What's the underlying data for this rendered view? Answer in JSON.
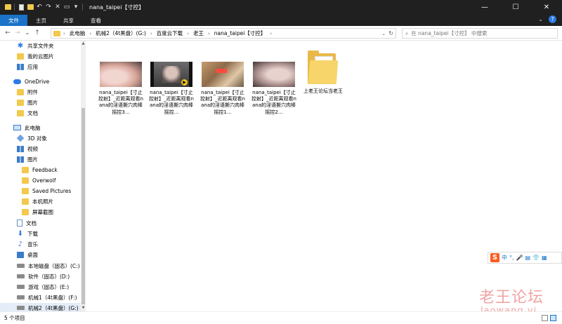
{
  "window": {
    "title": "nana_taipei【寸控】",
    "min_symbol": "—",
    "max_symbol": "☐",
    "close_symbol": "✕"
  },
  "quick_access": {
    "down_arrow": "▾"
  },
  "ribbon": {
    "tabs": [
      {
        "label": "文件",
        "active": true
      },
      {
        "label": "主页",
        "active": false
      },
      {
        "label": "共享",
        "active": false
      },
      {
        "label": "查看",
        "active": false
      }
    ],
    "expand_symbol": "⌄",
    "help_symbol": "?"
  },
  "navigation": {
    "back": "←",
    "forward": "→",
    "recent": "⌄",
    "up": "↑"
  },
  "address": {
    "crumbs": [
      "此电脑",
      "机械2（4t黑盘）(G:)",
      "百度云下载",
      "老王",
      "nana_taipei【寸控】"
    ],
    "separator": "›",
    "dropdown": "⌄",
    "refresh": "↻"
  },
  "search": {
    "placeholder": "在 nana_taipei【寸控】 中搜索",
    "icon": "⌕"
  },
  "nav_pane": {
    "items": [
      {
        "label": "共享文件夹",
        "icon": "star-icon",
        "indent": 1
      },
      {
        "label": "我的云图片",
        "icon": "folder-icon",
        "indent": 1
      },
      {
        "label": "应用",
        "icon": "apps-icon",
        "indent": 1
      },
      {
        "label": "OneDrive",
        "icon": "cloud-icon",
        "indent": 0
      },
      {
        "label": "附件",
        "icon": "folder-icon",
        "indent": 1
      },
      {
        "label": "图片",
        "icon": "folder-icon",
        "indent": 1
      },
      {
        "label": "文档",
        "icon": "folder-icon",
        "indent": 1
      },
      {
        "label": "此电脑",
        "icon": "pc-icon",
        "indent": 0
      },
      {
        "label": "3D 对象",
        "icon": "3d-objects-icon",
        "indent": 1
      },
      {
        "label": "视频",
        "icon": "video-icon",
        "indent": 1
      },
      {
        "label": "图片",
        "icon": "pictures-icon",
        "indent": 1
      },
      {
        "label": "Feedback",
        "icon": "folder-icon",
        "indent": 2
      },
      {
        "label": "Overwolf",
        "icon": "folder-icon",
        "indent": 2
      },
      {
        "label": "Saved Pictures",
        "icon": "folder-icon",
        "indent": 2
      },
      {
        "label": "本机照片",
        "icon": "folder-icon",
        "indent": 2
      },
      {
        "label": "屏幕截图",
        "icon": "folder-icon",
        "indent": 2
      },
      {
        "label": "文档",
        "icon": "document-icon",
        "indent": 1
      },
      {
        "label": "下载",
        "icon": "download-icon",
        "indent": 1
      },
      {
        "label": "音乐",
        "icon": "music-icon",
        "indent": 1
      },
      {
        "label": "桌面",
        "icon": "desktop-icon",
        "indent": 1
      },
      {
        "label": "本地磁盘（固态）(C:)",
        "icon": "drive-icon",
        "indent": 1
      },
      {
        "label": "软件（固态）(D:)",
        "icon": "drive-icon",
        "indent": 1
      },
      {
        "label": "游戏（固态）(E:)",
        "icon": "drive-icon",
        "indent": 1
      },
      {
        "label": "机械1（4t黑盘）(F:)",
        "icon": "drive-icon",
        "indent": 1
      },
      {
        "label": "机械2（4t黑盘）(G:)",
        "icon": "drive-icon",
        "indent": 1
      }
    ],
    "scroll_up": "▲",
    "scroll_down": "▼"
  },
  "files": [
    {
      "name": "nana_taipei【寸止控射】_近距离观看nana的淫语撕穴肉棒摇控3...",
      "type": "video"
    },
    {
      "name": "nana_taipei【寸止控射】_近距离观看nana的淫语撕穴肉棒摇控...",
      "type": "video"
    },
    {
      "name": "nana_taipei【寸止控射】_近距离观看nana的淫语撕穴肉棒摇控1...",
      "type": "video"
    },
    {
      "name": "nana_taipei【寸止控射】_近距离观看nana的淫语撕穴肉棒摇控2...",
      "type": "video"
    },
    {
      "name": "上老王论坛当老王",
      "type": "folder"
    }
  ],
  "status": {
    "item_count": "5 个项目"
  },
  "ime": {
    "logo": "S",
    "mode": "中",
    "punct": "°,",
    "mic": "🎤",
    "kbd": "▤",
    "skin": "👕",
    "tools": "▦"
  },
  "watermark": {
    "line1": "老王论坛",
    "line2": "laowang.vi"
  }
}
